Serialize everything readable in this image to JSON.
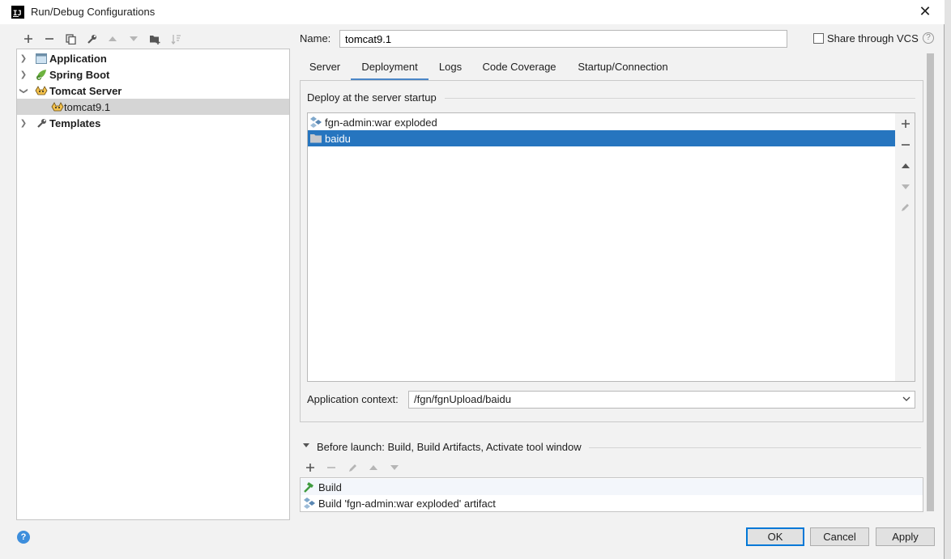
{
  "window": {
    "title": "Run/Debug Configurations"
  },
  "left_toolbar": {
    "icons": [
      "plus-icon",
      "minus-icon",
      "copy-icon",
      "wrench-icon",
      "arrow-up-icon",
      "arrow-down-icon",
      "folder-add-icon",
      "sort-icon"
    ]
  },
  "tree": {
    "items": [
      {
        "label": "Application",
        "icon": "application-icon",
        "expanded": false
      },
      {
        "label": "Spring Boot",
        "icon": "spring-boot-icon",
        "expanded": false
      },
      {
        "label": "Tomcat Server",
        "icon": "tomcat-icon",
        "expanded": true
      },
      {
        "label": "tomcat9.1",
        "icon": "tomcat-icon",
        "selected": true
      },
      {
        "label": "Templates",
        "icon": "wrench-icon",
        "expanded": false
      }
    ]
  },
  "name_field": {
    "label": "Name:",
    "value": "tomcat9.1"
  },
  "share": {
    "label": "Share through VCS",
    "checked": false
  },
  "tabs": [
    {
      "label": "Server"
    },
    {
      "label": "Deployment",
      "active": true
    },
    {
      "label": "Logs"
    },
    {
      "label": "Code Coverage"
    },
    {
      "label": "Startup/Connection"
    }
  ],
  "deployment": {
    "section_title": "Deploy at the server startup",
    "items": [
      {
        "label": "fgn-admin:war exploded",
        "icon": "artifact-icon"
      },
      {
        "label": "baidu",
        "icon": "folder-icon",
        "selected": true
      }
    ],
    "context_label": "Application context:",
    "context_value": "/fgn/fgnUpload/baidu"
  },
  "before_launch": {
    "title": "Before launch: Build, Build Artifacts, Activate tool window",
    "items": [
      {
        "label": "Build",
        "icon": "hammer-icon"
      },
      {
        "label": "Build 'fgn-admin:war exploded' artifact",
        "icon": "artifact-icon"
      }
    ]
  },
  "buttons": {
    "ok": "OK",
    "cancel": "Cancel",
    "apply": "Apply"
  },
  "colors": {
    "selection": "#2675bf",
    "tab_underline": "#4a86c7",
    "help": "#3d8edc"
  }
}
